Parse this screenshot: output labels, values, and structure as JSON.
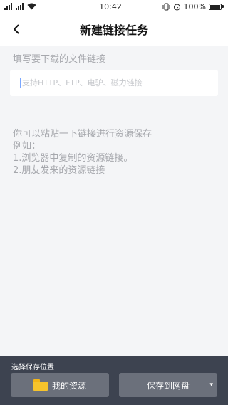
{
  "status_bar": {
    "time": "10:42",
    "battery_text": "100%",
    "icons": [
      "signal-icon",
      "signal-icon",
      "wifi-icon",
      "vibrate-icon",
      "alarm-icon",
      "battery-icon"
    ]
  },
  "header": {
    "title": "新建链接任务",
    "back_icon": "chevron-left-icon"
  },
  "main": {
    "label": "填写要下载的文件链接",
    "input_placeholder": "支持HTTP、FTP、电驴、磁力链接",
    "input_value": "",
    "hints": [
      "你可以粘贴一下链接进行资源保存",
      "例如：",
      "1.浏览器中复制的资源链接。",
      "2.朋友发来的资源链接"
    ]
  },
  "bottom_panel": {
    "label": "选择保存位置",
    "my_resources_label": "我的资源",
    "save_to_label": "保存到网盘",
    "folder_icon": "folder-icon"
  },
  "colors": {
    "background": "#f4f5f7",
    "panel": "#3d4350",
    "button": "#6b707b",
    "folder": "#f7c42c"
  }
}
